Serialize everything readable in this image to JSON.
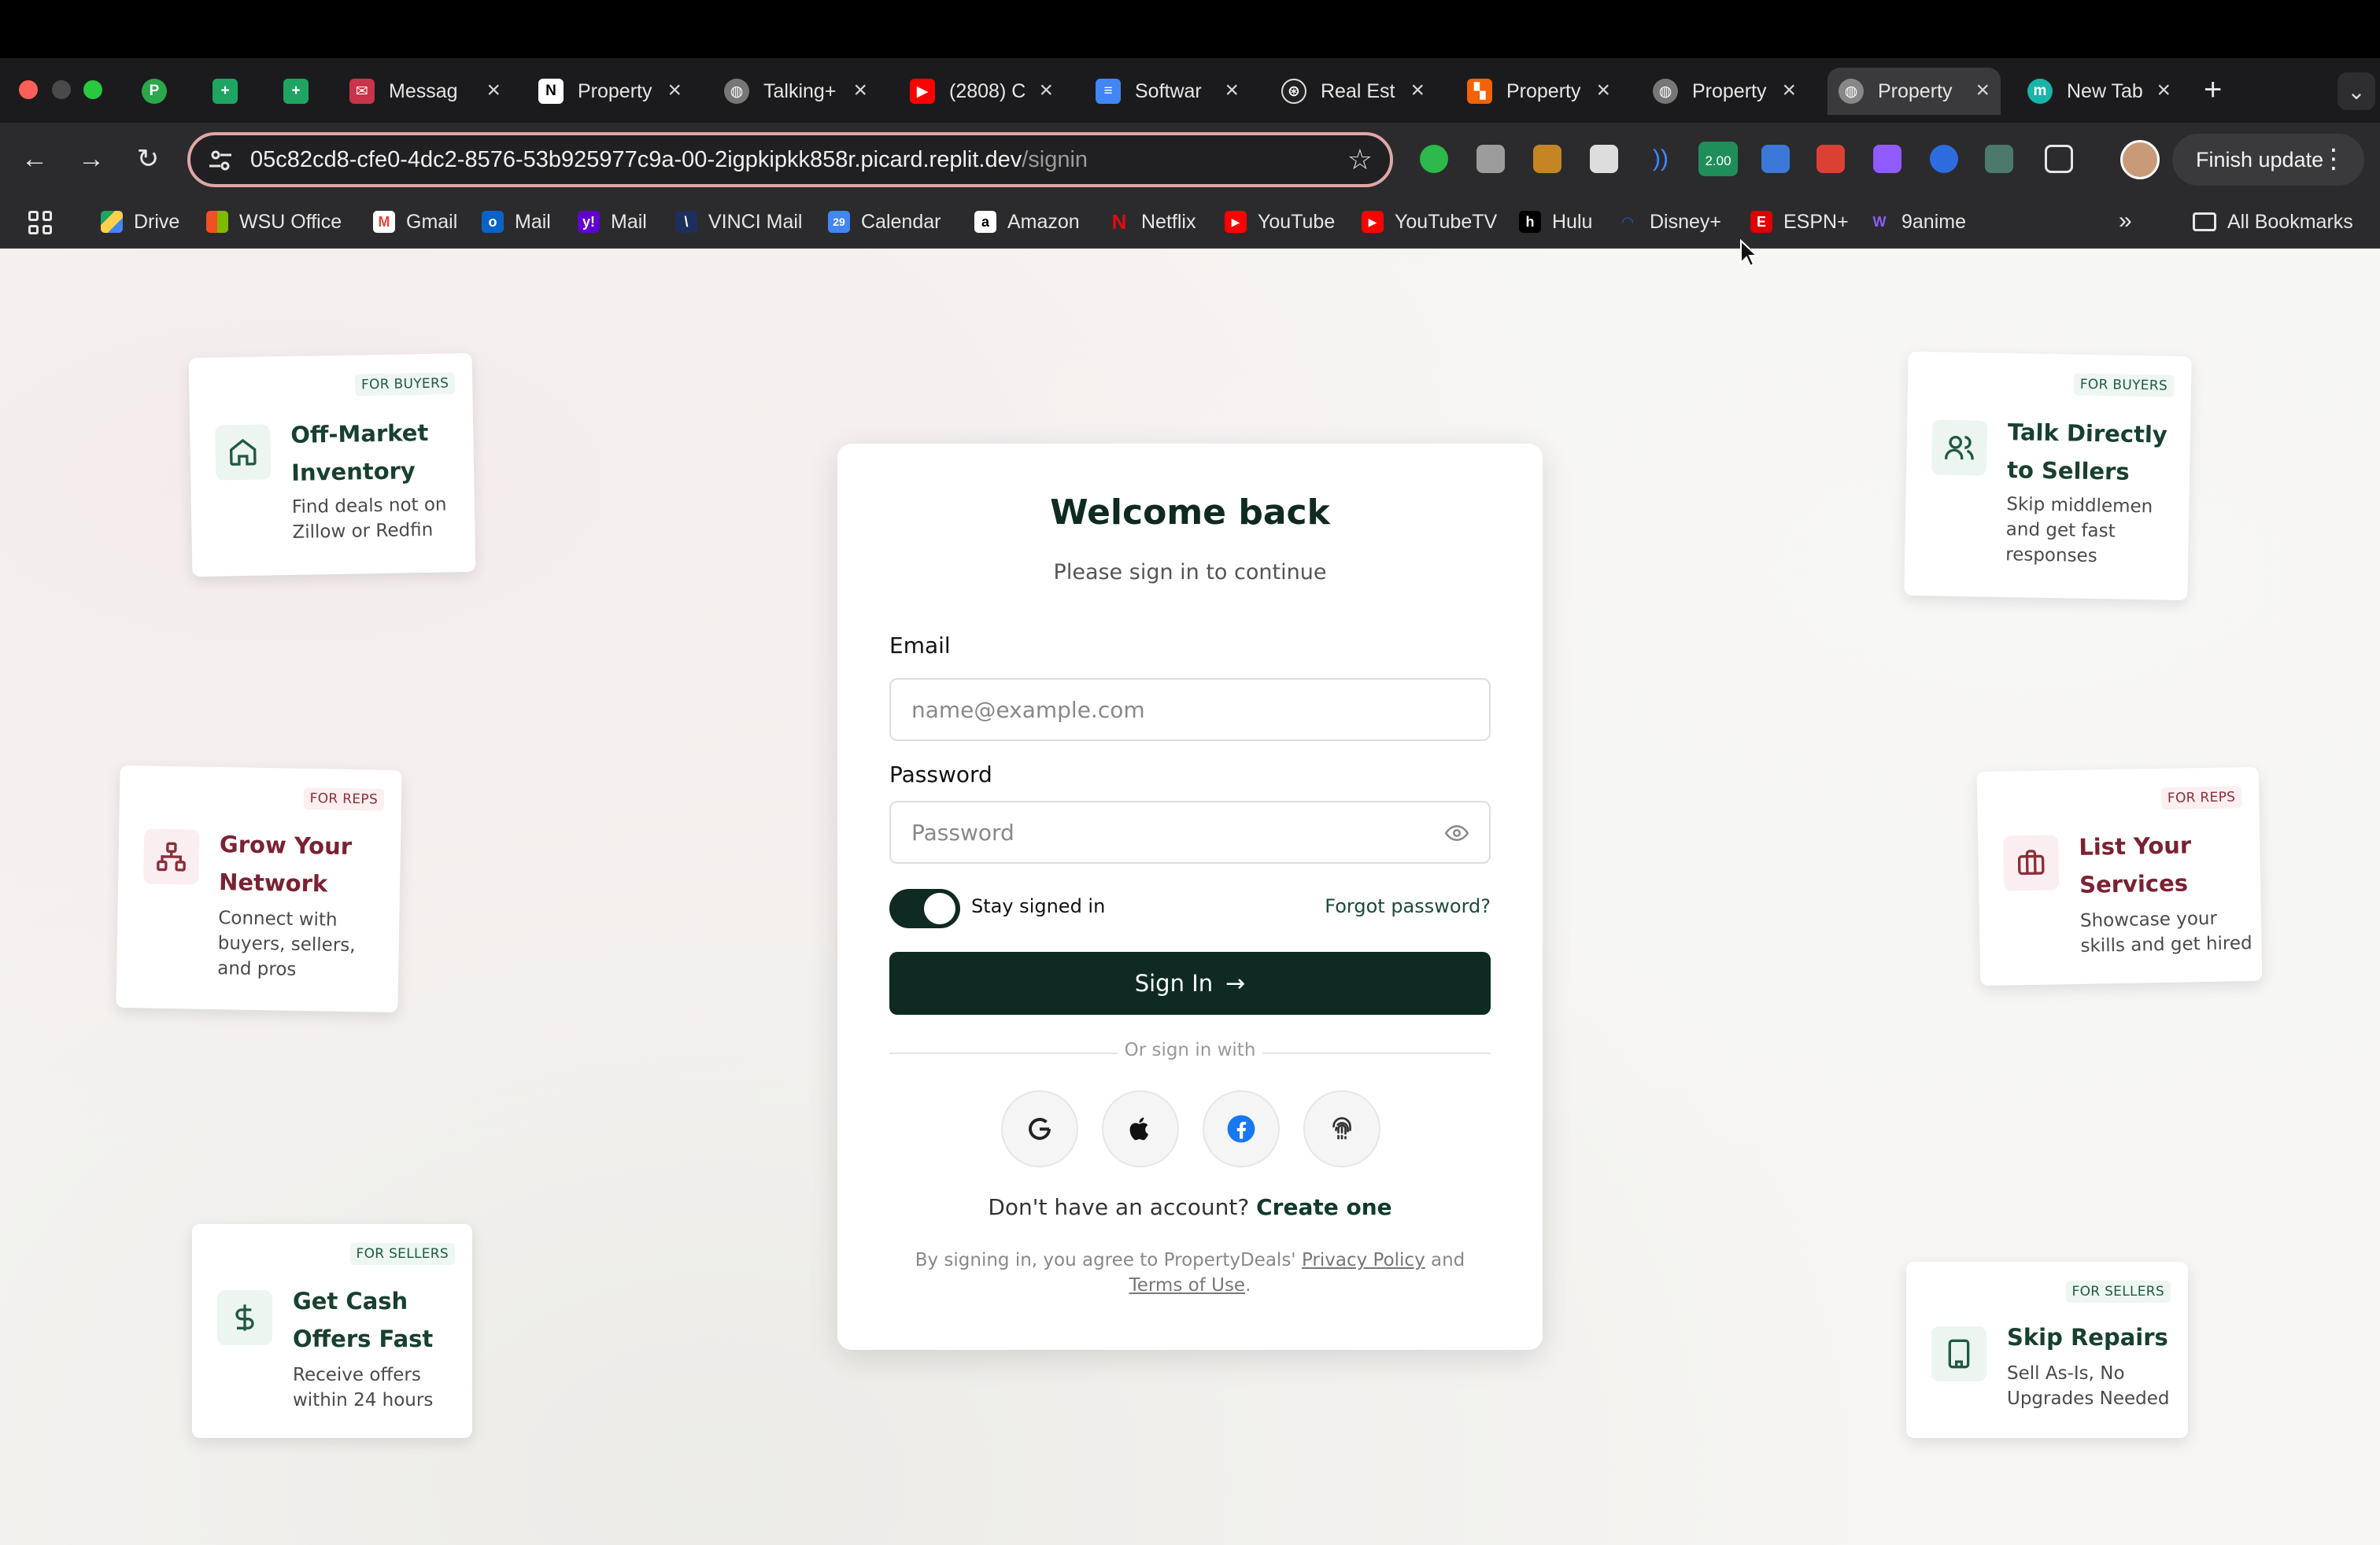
{
  "browser": {
    "tabs": [
      {
        "title": "",
        "icon": "p-green-icon"
      },
      {
        "title": "",
        "icon": "sheets-icon"
      },
      {
        "title": "",
        "icon": "sheets-icon"
      },
      {
        "title": "Messag",
        "icon": "message-icon"
      },
      {
        "title": "Property",
        "icon": "notion-icon"
      },
      {
        "title": "Talking+",
        "icon": "globe-icon"
      },
      {
        "title": "(2808) C",
        "icon": "youtube-icon"
      },
      {
        "title": "Softwar",
        "icon": "docs-icon"
      },
      {
        "title": "Real Est",
        "icon": "openai-icon"
      },
      {
        "title": "Property",
        "icon": "replit-icon"
      },
      {
        "title": "Property",
        "icon": "globe-icon"
      },
      {
        "title": "Property",
        "icon": "globe-icon",
        "active": true
      },
      {
        "title": "New Tab",
        "icon": "m-icon"
      }
    ],
    "url_main": "05c82cd8-cfe0-4dc2-8576-53b925977c9a-00-2igpkipkk858r.picard.replit.dev",
    "url_path": "/signin",
    "ext_badge": "2.00",
    "finish_update": "Finish update",
    "bookmarks": [
      "Drive",
      "WSU Office",
      "Gmail",
      "Mail",
      "Mail",
      "VINCI Mail",
      "Calendar",
      "Amazon",
      "Netflix",
      "YouTube",
      "YouTubeTV",
      "Hulu",
      "Disney+",
      "ESPN+",
      "9anime"
    ],
    "all_bookmarks": "All Bookmarks"
  },
  "features": {
    "left": [
      {
        "tag": "FOR BUYERS",
        "title1": "Off-Market",
        "title2": "Inventory",
        "desc1": "Find deals not on",
        "desc2": "Zillow or Redfin",
        "desc3": "",
        "icon": "home-icon"
      },
      {
        "tag": "FOR REPS",
        "title1": "Grow Your",
        "title2": "Network",
        "desc1": "Connect with",
        "desc2": "buyers, sellers,",
        "desc3": "and pros",
        "icon": "network-icon"
      },
      {
        "tag": "FOR SELLERS",
        "title1": "Get Cash",
        "title2": "Offers Fast",
        "desc1": "Receive offers",
        "desc2": "within 24 hours",
        "desc3": "",
        "icon": "dollar-icon"
      }
    ],
    "right": [
      {
        "tag": "FOR BUYERS",
        "title1": "Talk Directly",
        "title2": "to Sellers",
        "desc1": "Skip middlemen",
        "desc2": "and get fast",
        "desc3": "responses",
        "icon": "users-icon"
      },
      {
        "tag": "FOR REPS",
        "title1": "List Your",
        "title2": "Services",
        "desc1": "Showcase your",
        "desc2": "skills and get hired",
        "desc3": "",
        "icon": "briefcase-icon"
      },
      {
        "tag": "FOR SELLERS",
        "title1": "Skip Repairs",
        "title2": "",
        "desc1": "Sell As-Is, No",
        "desc2": "Upgrades Needed",
        "desc3": "",
        "icon": "building-icon"
      }
    ]
  },
  "signin": {
    "title": "Welcome back",
    "subtitle": "Please sign in to continue",
    "email_label": "Email",
    "email_placeholder": "name@example.com",
    "password_label": "Password",
    "password_placeholder": "Password",
    "stay_signed_in": "Stay signed in",
    "stay_signed_in_on": true,
    "forgot": "Forgot password?",
    "button": "Sign In",
    "or_text": "Or sign in with",
    "no_account": "Don't have an account?",
    "create": "Create one",
    "terms_prefix": "By signing in, you agree to PropertyDeals'",
    "privacy": "Privacy Policy",
    "and": "and",
    "terms": "Terms of Use",
    "period": "."
  },
  "colors": {
    "primary": "#0f2a22",
    "buyers_accent": "#17402f",
    "reps_accent": "#7a2232"
  }
}
